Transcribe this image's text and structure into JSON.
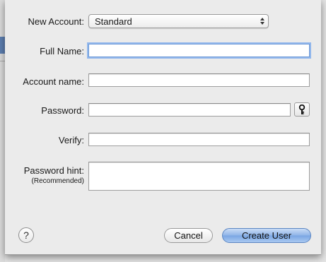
{
  "form": {
    "new_account_label": "New Account:",
    "account_type_value": "Standard",
    "full_name_label": "Full Name:",
    "full_name_value": "",
    "account_name_label": "Account name:",
    "account_name_value": "",
    "password_label": "Password:",
    "password_value": "",
    "verify_label": "Verify:",
    "verify_value": "",
    "hint_label": "Password hint:",
    "hint_sublabel": "(Recommended)",
    "hint_value": ""
  },
  "buttons": {
    "help_label": "?",
    "cancel_label": "Cancel",
    "create_label": "Create User"
  },
  "icons": {
    "popup": "up-down-arrows-icon",
    "password_assistant": "key-icon"
  },
  "colors": {
    "accent": "#6e9ad8",
    "default_button": "#8fb4e8"
  }
}
